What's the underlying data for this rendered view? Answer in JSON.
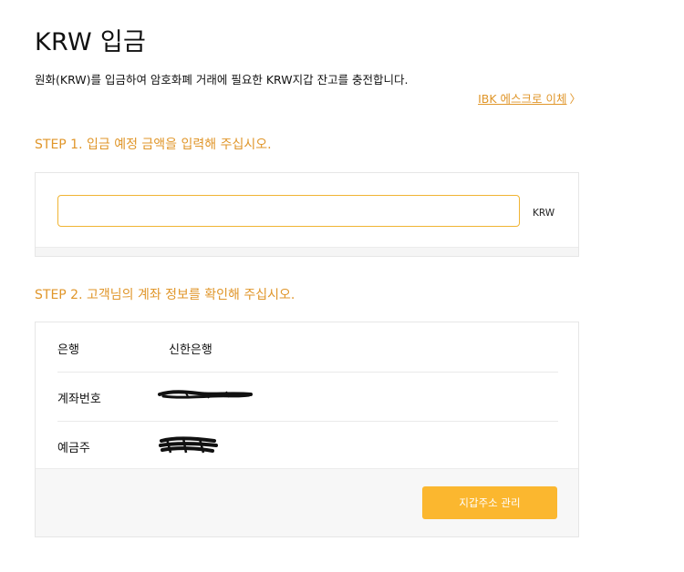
{
  "page": {
    "title": "KRW 입금",
    "description": "원화(KRW)를 입금하여 암호화폐 거래에 필요한 KRW지갑 잔고를 충전합니다.",
    "ibk_link_label": "IBK 에스크로 이체",
    "ibk_link_chevron": "〉"
  },
  "step1": {
    "title": "STEP 1. 입금 예정 금액을 입력해 주십시오.",
    "amount_value": "",
    "amount_placeholder": "",
    "unit": "KRW"
  },
  "step2": {
    "title": "STEP 2. 고객님의 계좌 정보를 확인해 주십시오.",
    "rows": [
      {
        "label": "은행",
        "value": "신한은행"
      },
      {
        "label": "계좌번호",
        "value": ""
      },
      {
        "label": "예금주",
        "value": ""
      }
    ],
    "wallet_button_label": "지갑주소 관리"
  },
  "colors": {
    "accent": "#e0962a",
    "button": "#fbb72f",
    "input_border": "#f0b433"
  }
}
